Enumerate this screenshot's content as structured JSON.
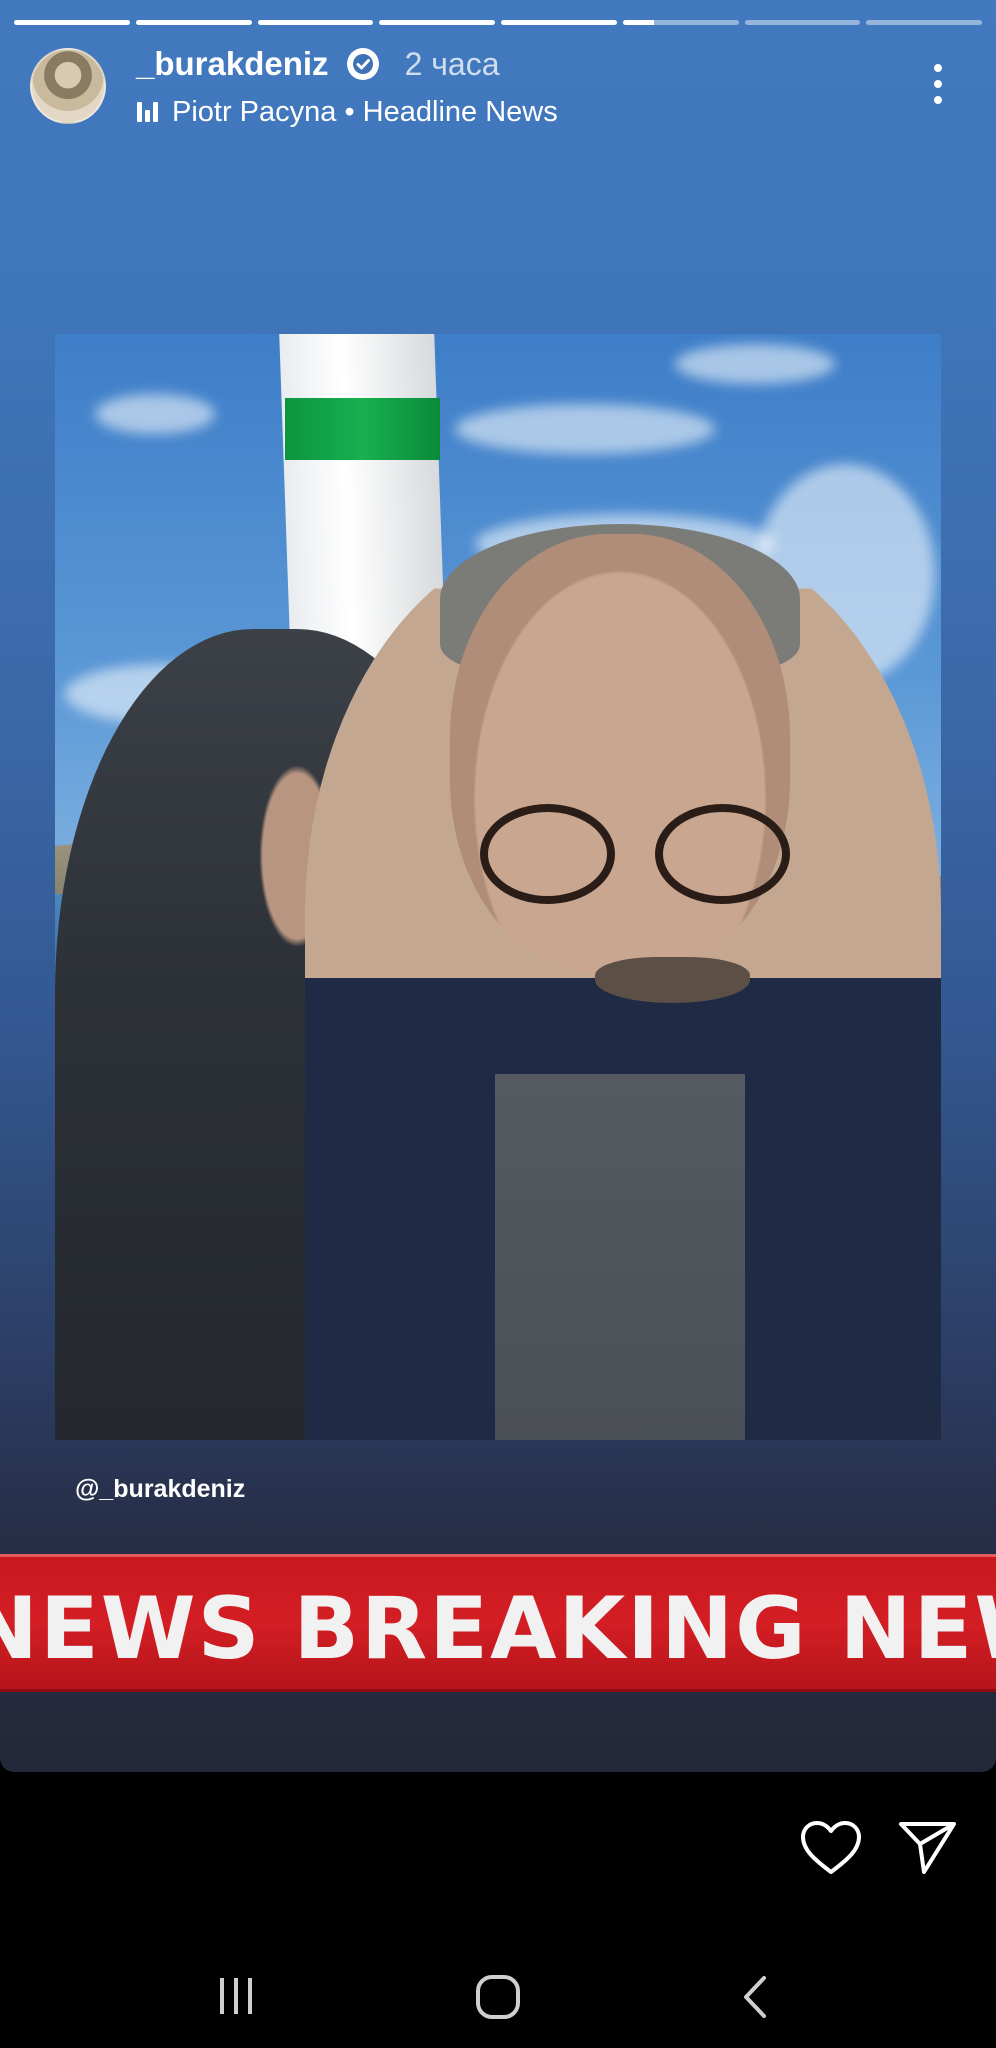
{
  "story": {
    "progress": [
      1,
      1,
      1,
      1,
      1,
      0.27,
      0,
      0
    ],
    "username": "_burakdeniz",
    "verified": true,
    "time": "2 часа",
    "music": "Piotr Pacyna • Headline News",
    "mention": "@_burakdeniz",
    "banner": "NEWS    BREAKING NEWS"
  },
  "icons": {
    "more": "more-vert-icon",
    "like": "heart-icon",
    "share": "send-icon",
    "music": "music-bars-icon",
    "verified": "verified-badge-icon"
  },
  "navbar": [
    "recent-apps",
    "home",
    "back"
  ]
}
